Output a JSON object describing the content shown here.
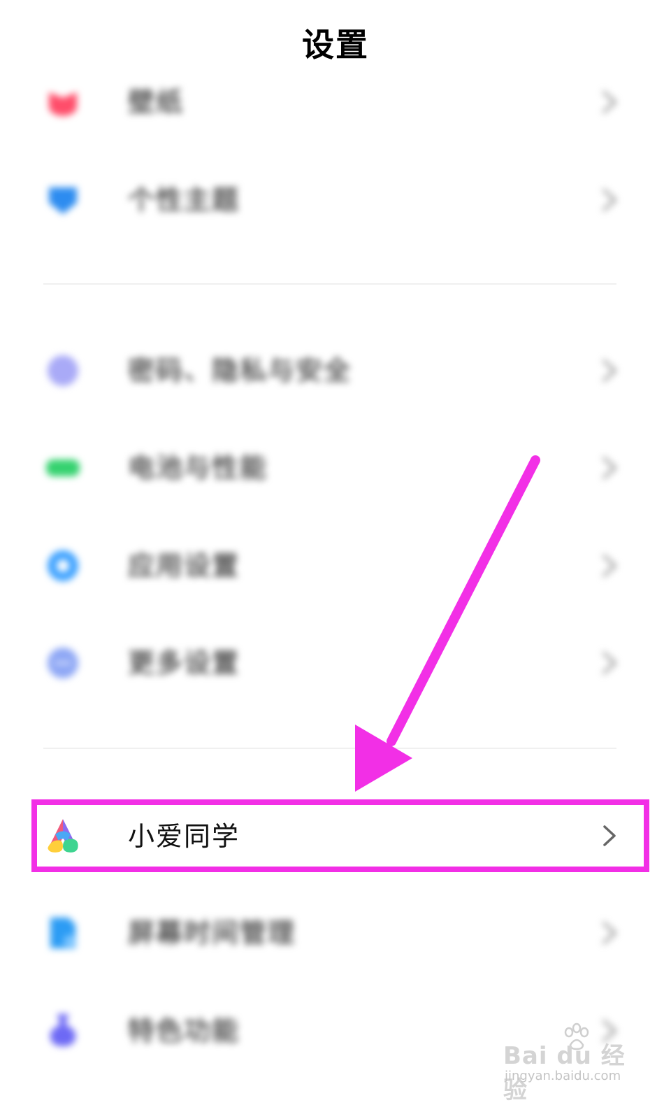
{
  "header": {
    "title": "设置"
  },
  "settings": {
    "items": [
      {
        "label": "壁纸"
      },
      {
        "label": "个性主题"
      },
      {
        "label": "密码、隐私与安全"
      },
      {
        "label": "电池与性能"
      },
      {
        "label": "应用设置"
      },
      {
        "label": "更多设置"
      },
      {
        "label": "小爱同学"
      },
      {
        "label": "屏幕时间管理"
      },
      {
        "label": "特色功能"
      }
    ]
  },
  "watermark": {
    "brand": "Bai du 经验",
    "url": "jingyan.baidu.com"
  },
  "colors": {
    "highlight": "#f22fe6",
    "wallpaper_icon": "#ff4d6a",
    "theme_icon": "#2d8cf0",
    "privacy_icon": "#a9aaf7",
    "battery_icon": "#35d26f",
    "app_settings_icon": "#3aa0ff",
    "more_settings_icon": "#8ea7f5",
    "screen_time_icon": "#2c9cf4",
    "features_icon": "#6d69f5"
  }
}
